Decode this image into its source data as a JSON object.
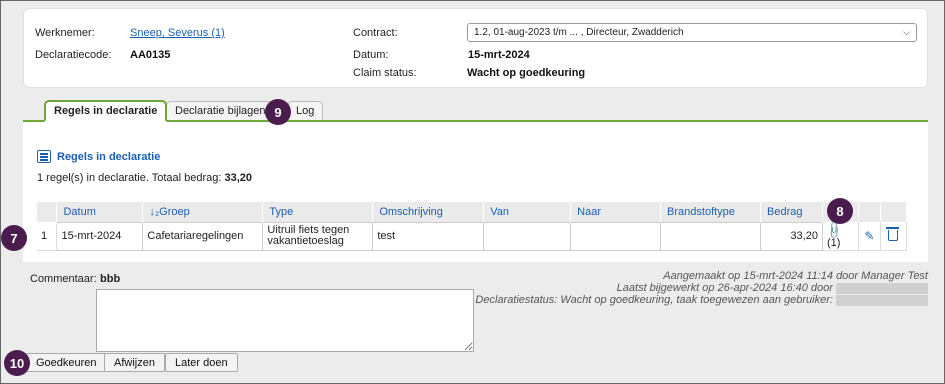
{
  "header": {
    "employee_label": "Werknemer:",
    "employee_value": "Sneep, Severus (1)",
    "code_label": "Declaratiecode:",
    "code_value": "AA0135",
    "contract_label": "Contract:",
    "contract_value": "1.2, 01-aug-2023 t/m ... , Directeur, Zwadderich",
    "date_label": "Datum:",
    "date_value": "15-mrt-2024",
    "status_label": "Claim status:",
    "status_value": "Wacht op goedkeuring"
  },
  "tabs": [
    {
      "label": "Regels in declaratie",
      "active": true
    },
    {
      "label": "Declaratie bijlagen",
      "active": false
    },
    {
      "label": "Log",
      "active": false
    }
  ],
  "section": {
    "title": "Regels in declaratie",
    "summary_prefix": "1 regel(s) in declaratie. Totaal bedrag: ",
    "summary_total": "33,20"
  },
  "table": {
    "headers": [
      "Datum",
      "↓₂Groep",
      "Type",
      "Omschrijving",
      "Van",
      "Naar",
      "Brandstoftype",
      "Bedrag"
    ],
    "rows": [
      {
        "index": "1",
        "datum": "15-mrt-2024",
        "groep": "Cafetariaregelingen",
        "type": "Uitruil fiets tegen vakantietoeslag",
        "omschrijving": "test",
        "van": "",
        "naar": "",
        "brandstoftype": "",
        "bedrag": "33,20",
        "attachments": "(1)"
      }
    ]
  },
  "comment": {
    "label": "Commentaar:",
    "value": "bbb"
  },
  "meta": {
    "created": "Aangemaakt op 15-mrt-2024 11:14 door Manager Test",
    "updated": "Laatst bijgewerkt op 26-apr-2024 16:40 door",
    "status": "Declaratiestatus: Wacht op goedkeuring, taak toegewezen aan gebruiker:"
  },
  "buttons": {
    "approve": "Goedkeuren",
    "reject": "Afwijzen",
    "later": "Later doen"
  },
  "badges": {
    "b7": "7",
    "b8": "8",
    "b9": "9",
    "b10": "10"
  },
  "colors": {
    "accent_green": "#6ea63a",
    "link_blue": "#1a5fb4",
    "badge_purple": "#4b1d4e"
  },
  "icons": [
    "list-icon",
    "paperclip-icon",
    "pencil-icon",
    "trash-icon",
    "chevron-down-icon"
  ]
}
